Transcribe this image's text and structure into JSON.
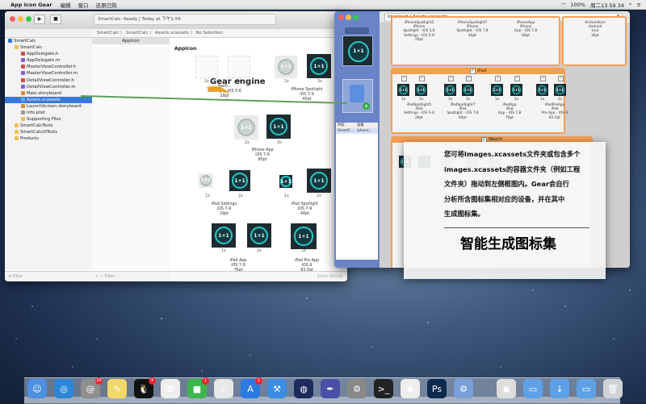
{
  "menubar": {
    "app_name": "App Icon Gear",
    "items": [
      "编辑",
      "窗口",
      "还原已购"
    ],
    "clock": "周二13 59 34",
    "battery": "100%"
  },
  "xcode": {
    "status": "SmartCalc: Ready  |  Today at 下午1:59",
    "jumpbar": "SmartCalc  〉 SmartCalc  〉 Assets.xcassets  〉 No Selection",
    "nav": [
      {
        "label": "SmartCalc",
        "indent": 0,
        "kind": "project"
      },
      {
        "label": "SmartCalc",
        "indent": 1,
        "kind": "folder"
      },
      {
        "label": "AppDelegate.h",
        "indent": 2,
        "kind": "h"
      },
      {
        "label": "AppDelegate.m",
        "indent": 2,
        "kind": "m"
      },
      {
        "label": "MasterViewController.h",
        "indent": 2,
        "kind": "h"
      },
      {
        "label": "MasterViewController.m",
        "indent": 2,
        "kind": "m"
      },
      {
        "label": "DetailViewController.h",
        "indent": 2,
        "kind": "h"
      },
      {
        "label": "DetailViewController.m",
        "indent": 2,
        "kind": "m"
      },
      {
        "label": "Main.storyboard",
        "indent": 2,
        "kind": "sb"
      },
      {
        "label": "Assets.xcassets",
        "indent": 2,
        "kind": "assets",
        "selected": true
      },
      {
        "label": "LaunchScreen.storyboard",
        "indent": 2,
        "kind": "sb"
      },
      {
        "label": "Info.plist",
        "indent": 2,
        "kind": "plist"
      },
      {
        "label": "Supporting Files",
        "indent": 2,
        "kind": "folder"
      },
      {
        "label": "SmartCalcTests",
        "indent": 1,
        "kind": "folder"
      },
      {
        "label": "SmartCalcUITests",
        "indent": 1,
        "kind": "folder"
      },
      {
        "label": "Products",
        "indent": 1,
        "kind": "folder"
      }
    ],
    "nav_filter": "Filter",
    "set_list_item": "AppIcon",
    "set_filter": "Filter",
    "canvas_title": "AppIcon",
    "show_slicing": "Show Slicing",
    "caps": {
      "spotlight_settings": [
        "Spotl…",
        "Settings - iOS 5-6",
        "29pt"
      ],
      "iphone_spotlight": [
        "iPhone Spotlight",
        "iOS 7-9",
        "40pt"
      ],
      "iphone_app": [
        "iPhone App",
        "iOS 7-9",
        "60pt"
      ],
      "ipad_settings": [
        "iPad Settings",
        "iOS 7-9",
        "29pt"
      ],
      "ipad_spotlight": [
        "iPad Spotlight",
        "iOS 7-9",
        "40pt"
      ],
      "ipad_app": [
        "iPad App",
        "iOS 7-9",
        "76pt"
      ],
      "ipad_pro_app": [
        "iPad Pro App",
        "iOS 9",
        "83.5pt"
      ]
    },
    "scale_1x": "1x",
    "scale_2x": "2x",
    "scale_3x": "3x",
    "icon_glyph": "1+1"
  },
  "gear": {
    "title": "Imageset  |  Assets.xcassets",
    "side_list": {
      "col1": "目标",
      "col2": "设备",
      "row1": "SmartC…",
      "row2": "iphone…"
    },
    "iphone_caps": [
      [
        "iPhoneSpotlight5",
        "iPhone",
        "Spotlight - iOS 5,6",
        "Settings - iOS 5-8",
        "29pt"
      ],
      [
        "iPhoneSpotlight7",
        "iPhone",
        "Spotlight - iOS 7,8",
        "40pt"
      ],
      [
        "iPhoneApp",
        "iPhone",
        "App - iOS 7,8",
        "60pt"
      ],
      [
        "AndroidIcon",
        "Android",
        "Icon",
        "36pt"
      ]
    ],
    "ipad_header": "iPad",
    "ipad_caps": [
      [
        "iPadSpotlight5",
        "iPad",
        "Settings - iOS 5-8",
        "29pt"
      ],
      [
        "iPadSpotlight7",
        "iPad",
        "Spotlight - iOS 7,8",
        "40pt"
      ],
      [
        "iPadApp",
        "iPad",
        "App - iOS 7,8",
        "76pt"
      ],
      [
        "iPadProApp",
        "iPad",
        "Pro App - iOS 9",
        "83.5pt"
      ]
    ],
    "watch_header": "Watch",
    "check": "✓"
  },
  "overlay": {
    "gear_engine": "Gear engine",
    "lines": [
      "您可将Images.xcassets文件夹或包含多个",
      "images.xcassets的容器文件夹（例如工程",
      "文件夹）拖动到左侧框图内。Gear会自行",
      "分析所含图标集相对应的设备，并在其中",
      "生成图标集。"
    ],
    "headline": "智能生成图标集"
  },
  "dock": {
    "badges": {
      "contacts": "24",
      "qq": "4",
      "facetime": "1",
      "appstore": "1"
    }
  },
  "colors": {
    "accent": "#3a78d8",
    "orange": "#f3a055",
    "teal": "#27c8c8",
    "gear_side": "#6b84c8",
    "connector": "#5fa05a"
  }
}
